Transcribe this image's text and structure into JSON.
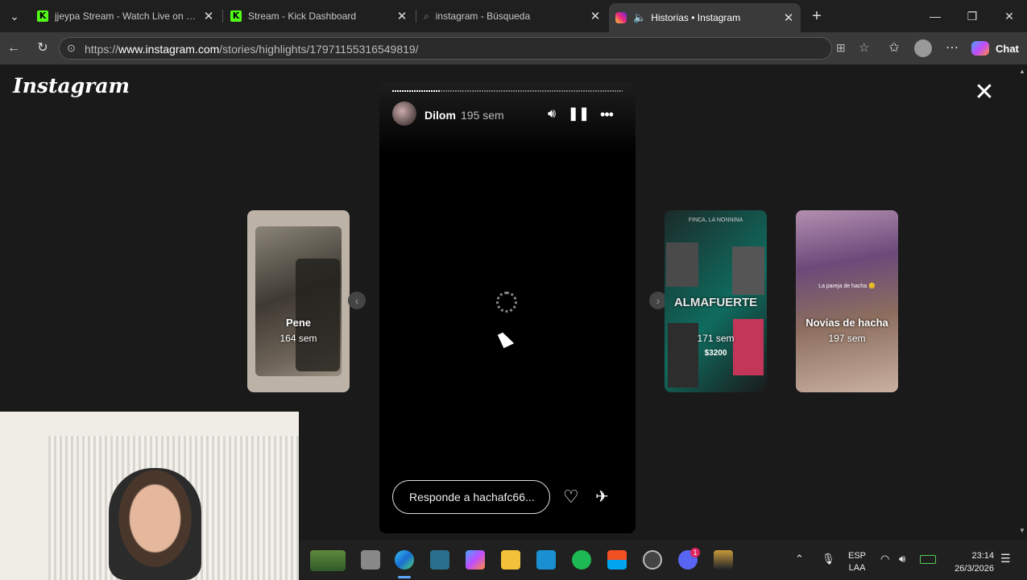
{
  "tabs": [
    {
      "title": "jjeypa Stream - Watch Live on Kick",
      "icon": "kick-icon"
    },
    {
      "title": "Stream - Kick Dashboard",
      "icon": "kick-icon"
    },
    {
      "title": "instagram - Búsqueda",
      "icon": "search-icon"
    },
    {
      "title": "Historias • Instagram",
      "icon": "instagram-icon",
      "active": true
    }
  ],
  "kick_letter": "K",
  "address": {
    "prefix": "https://",
    "domain": "www.instagram.com",
    "path": "/stories/highlights/17971155316549819/"
  },
  "toolbar": {
    "chat_label": "Chat"
  },
  "page": {
    "logo": "Instagram"
  },
  "story": {
    "username": "Dilom",
    "time": "195 sem",
    "progress": 0.21,
    "reply_placeholder": "Responde a hachafc66..."
  },
  "cards": [
    {
      "name": "Pene",
      "time": "164 sem"
    },
    {
      "name": "ALMAFUERTE",
      "time": "171 sem",
      "overlay_top": "FINCA, LA NONNINA",
      "overlay_price": "$3200"
    },
    {
      "name": "Novias de hacha",
      "time": "197 sem",
      "overlay_caption": "La pareja de hacha 😊"
    }
  ],
  "tray": {
    "lang1": "ESP",
    "lang2": "LAA",
    "time": "23:14",
    "date": "26/3/2026",
    "discord_badge": "1"
  },
  "colors": {
    "kick": "#53fc18",
    "bg": "#1a1a1a",
    "story_bg": "#000000"
  }
}
